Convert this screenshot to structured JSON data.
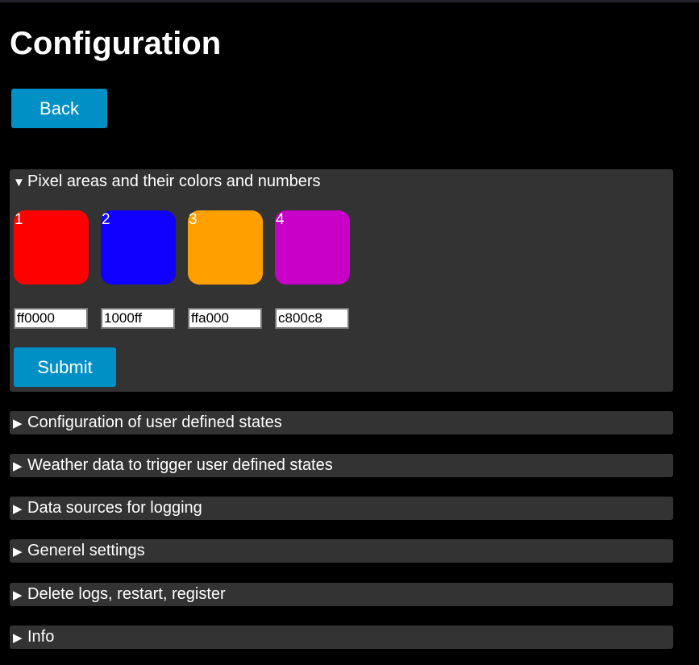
{
  "page": {
    "title": "Configuration",
    "back_label": "Back"
  },
  "pixel_section": {
    "summary": "Pixel areas and their colors and numbers",
    "expanded_marker": "▼",
    "areas": [
      {
        "number": "1",
        "color": "#ff0000",
        "hex": "ff0000"
      },
      {
        "number": "2",
        "color": "#1000ff",
        "hex": "1000ff"
      },
      {
        "number": "3",
        "color": "#ffa000",
        "hex": "ffa000"
      },
      {
        "number": "4",
        "color": "#c800c8",
        "hex": "c800c8"
      }
    ],
    "submit_label": "Submit"
  },
  "sections": [
    {
      "summary": "Configuration of user defined states",
      "marker": "▶"
    },
    {
      "summary": "Weather data to trigger user defined states",
      "marker": "▶"
    },
    {
      "summary": "Data sources for logging",
      "marker": "▶"
    },
    {
      "summary": "Generel settings",
      "marker": "▶"
    },
    {
      "summary": "Delete logs, restart, register",
      "marker": "▶"
    },
    {
      "summary": "Info",
      "marker": "▶"
    }
  ],
  "colors": {
    "accent": "#0190c6",
    "panel": "#333333",
    "background": "#000000"
  }
}
